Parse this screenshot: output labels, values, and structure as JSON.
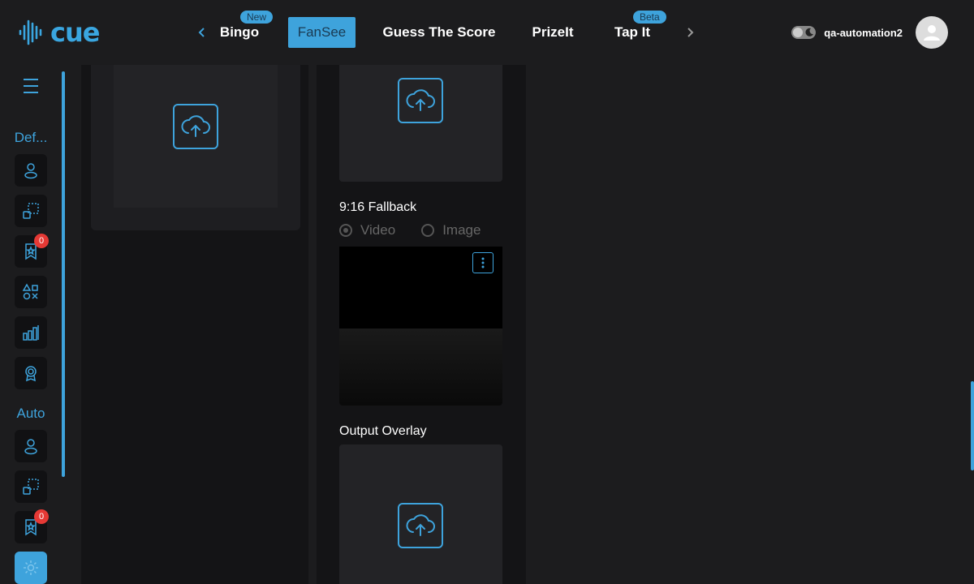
{
  "app": {
    "logo_text": "cue"
  },
  "nav": {
    "tabs": [
      {
        "label": "Bingo",
        "badge": "New"
      },
      {
        "label": "FanSee",
        "active": true
      },
      {
        "label": "Guess The Score"
      },
      {
        "label": "PrizeIt"
      },
      {
        "label": "Tap It",
        "badge": "Beta"
      }
    ]
  },
  "user": {
    "name": "qa-automation2"
  },
  "sidebar": {
    "groups": [
      {
        "label": "Def..."
      },
      {
        "label": "Auto"
      }
    ],
    "badge_counts": [
      "0",
      "0"
    ]
  },
  "main": {
    "fallback_title": "9:16 Fallback",
    "media_options": [
      "Video",
      "Image"
    ],
    "selected_media": "Video",
    "overlay_title": "Output Overlay"
  },
  "colors": {
    "accent": "#3ea3dc",
    "badge_red": "#e53935",
    "background": "#1c1c1e"
  }
}
